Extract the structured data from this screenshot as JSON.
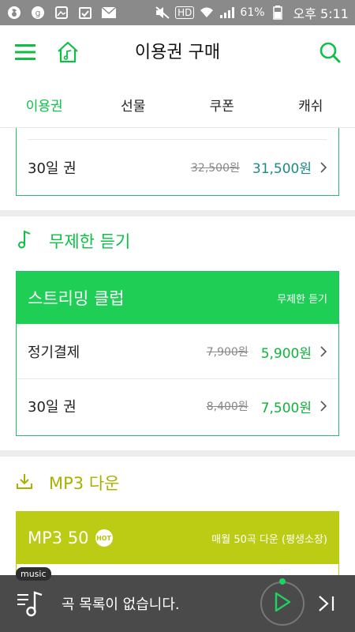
{
  "status_bar": {
    "battery": "61%",
    "time": "오후 5:11",
    "network": "HD"
  },
  "header": {
    "title": "이용권 구매"
  },
  "tabs": [
    {
      "label": "이용권",
      "active": true
    },
    {
      "label": "선물",
      "active": false
    },
    {
      "label": "쿠폰",
      "active": false
    },
    {
      "label": "캐쉬",
      "active": false
    }
  ],
  "top_card": {
    "row": {
      "label": "30일 권",
      "old_price": "32,500원",
      "new_price": "31,500원"
    }
  },
  "unlimited": {
    "section_title": "무제한 듣기",
    "banner_title": "스트리밍 클럽",
    "banner_sub": "무제한 듣기",
    "rows": [
      {
        "label": "정기결제",
        "old_price": "7,900원",
        "new_price": "5,900원"
      },
      {
        "label": "30일 권",
        "old_price": "8,400원",
        "new_price": "7,500원"
      }
    ]
  },
  "mp3": {
    "section_title": "MP3 다운",
    "banner_title": "MP3 50",
    "hot_badge": "HOT",
    "banner_sub": "매월 50곡 다운 (평생소장)"
  },
  "player": {
    "tag": "music",
    "text": "곡 목록이 없습니다."
  },
  "colors": {
    "green": "#0cc046",
    "banner_green": "#1ece55",
    "banner_olive": "#bccb14",
    "price_teal": "#1a8a88",
    "status_gray": "#8a8a8a",
    "player_bg": "#4a4a4a"
  }
}
